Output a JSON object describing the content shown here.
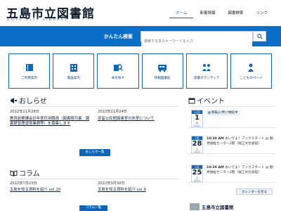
{
  "header": {
    "title": "五島市立図書館",
    "subtitle": "GOTO CITY LIBRARY",
    "nav": [
      {
        "label": "ホーム",
        "active": true
      },
      {
        "label": "新着情報",
        "active": false
      },
      {
        "label": "図書検索",
        "active": false
      },
      {
        "label": "リンク",
        "active": false
      }
    ]
  },
  "search": {
    "label": "かんたん検索",
    "placeholder": "検索する本のキーワードを入力"
  },
  "services": [
    {
      "label": "ご利用案内",
      "icon": "book-icon"
    },
    {
      "label": "施設案内",
      "icon": "building-icon"
    },
    {
      "label": "本を探す",
      "icon": "search-book-icon"
    },
    {
      "label": "移動図書館",
      "icon": "bus-icon"
    },
    {
      "label": "読書ボランティア",
      "icon": "volunteer-icon"
    },
    {
      "label": "こどものページ",
      "icon": "child-icon"
    }
  ],
  "news": {
    "heading": "おしらせ",
    "items": [
      {
        "date": "2022年11月26日",
        "title": "教育総務課会計年度任用職員（図書館司書、図書館管理運営業務等）を募集します"
      },
      {
        "date": "2022年11月24日",
        "title": "奈留公民館図書室の休室について"
      }
    ],
    "more": "おしらせ一覧"
  },
  "column": {
    "heading": "コラム",
    "items": [
      {
        "date": "2022年7月23日",
        "title": "五島を知る資料を紹介 vol.10"
      },
      {
        "date": "2022年3月30日",
        "title": "五島を知る資料を紹介 vol.9"
      }
    ],
    "more": "コラム一覧"
  },
  "events": {
    "heading": "イベント",
    "items": [
      {
        "month": "12月",
        "day": "1",
        "weekday": "木",
        "year": "2022",
        "time": "",
        "text": "移転に伴い休館中",
        "badge": true
      },
      {
        "month": "1月",
        "day": "28",
        "weekday": "土",
        "year": "2022",
        "time": "10:30 AM",
        "text": "おいでよ！ブックスタート @ 勤労福祉センター2階（福江文化会館）"
      },
      {
        "month": "1月",
        "day": "25",
        "weekday": "土",
        "year": "2022",
        "time": "10:30 AM",
        "text": "おいでよ！ブックスタート @ 勤労福祉センター2階（福江文化会館）"
      }
    ],
    "more": "カレンダーを見る"
  },
  "footer_logo": "五島市立図書館",
  "colors": {
    "primary": "#0c6fc7",
    "navy": "#1264b4"
  }
}
